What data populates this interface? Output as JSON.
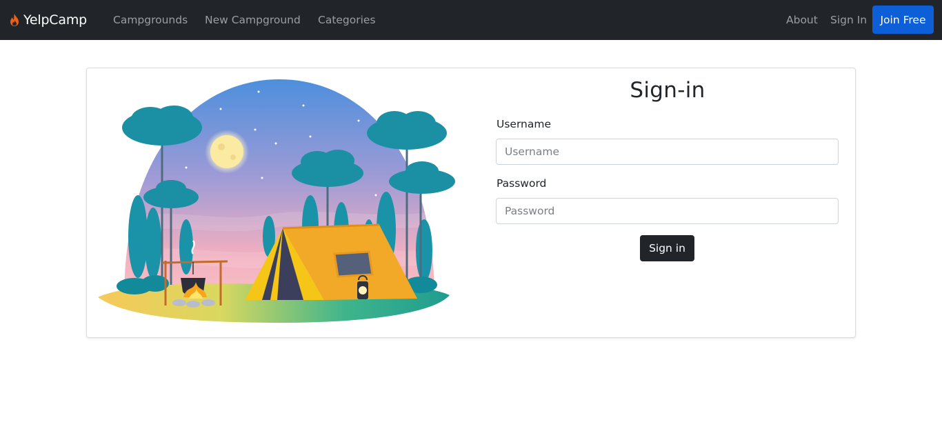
{
  "navbar": {
    "brand": "YelpCamp",
    "brand_icon": "flame-icon",
    "brand_icon_color": "#e8621a",
    "links": [
      "Campgrounds",
      "New Campground",
      "Categories"
    ],
    "right_links": [
      "About",
      "Sign In"
    ],
    "join_label": "Join Free",
    "join_color": "#0d5fd8"
  },
  "form": {
    "title": "Sign-in",
    "username_label": "Username",
    "username_placeholder": "Username",
    "username_value": "",
    "password_label": "Password",
    "password_placeholder": "Password",
    "password_value": "",
    "submit_label": "Sign in"
  },
  "illustration": {
    "icon": "camping-tent-illustration"
  }
}
